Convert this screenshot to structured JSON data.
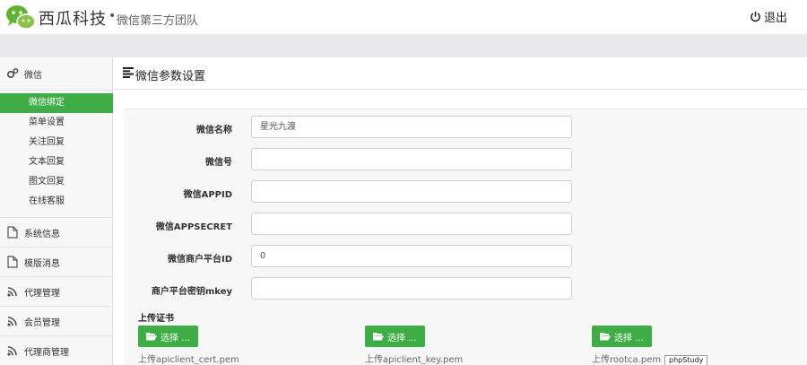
{
  "header": {
    "brand": "西瓜科技",
    "separator": "•",
    "slogan": "微信第三方团队",
    "logout_label": "退出"
  },
  "sidebar": {
    "sections": [
      {
        "label": "微信",
        "icon": "gears-icon"
      },
      {
        "label": "系统信息",
        "icon": "file-icon"
      },
      {
        "label": "模版消息",
        "icon": "file-icon"
      },
      {
        "label": "代理管理",
        "icon": "rss-icon"
      },
      {
        "label": "会员管理",
        "icon": "rss-icon"
      },
      {
        "label": "代理商管理",
        "icon": "rss-icon"
      }
    ],
    "sub_items": [
      {
        "label": "微信绑定",
        "active": true
      },
      {
        "label": "菜单设置",
        "active": false
      },
      {
        "label": "关注回复",
        "active": false
      },
      {
        "label": "文本回复",
        "active": false
      },
      {
        "label": "图文回复",
        "active": false
      },
      {
        "label": "在线客服",
        "active": false
      }
    ]
  },
  "page": {
    "title": "微信参数设置"
  },
  "form": {
    "fields": [
      {
        "label": "微信名称",
        "value": "星光九渡"
      },
      {
        "label": "微信号",
        "value": ""
      },
      {
        "label": "微信APPID",
        "value": ""
      },
      {
        "label": "微信APPSECRET",
        "value": ""
      },
      {
        "label": "微信商户平台ID",
        "value": "0"
      },
      {
        "label": "商户平台密钥mkey",
        "value": ""
      }
    ]
  },
  "certs": {
    "title": "上传证书",
    "choose_label": "选择 ...",
    "files": [
      {
        "name": "上传apiclient_cert.pem"
      },
      {
        "name": "上传apiclient_key.pem"
      },
      {
        "name": "上传rootca.pem"
      }
    ]
  },
  "tooltip": "phpStudy",
  "colors": {
    "accent": "#3fad45",
    "panel": "#f7f7f7",
    "graybar": "#e9e9ec"
  }
}
